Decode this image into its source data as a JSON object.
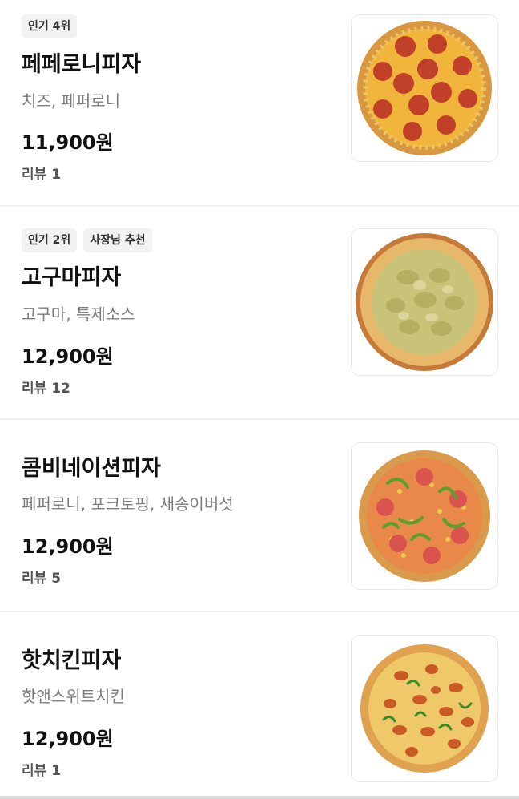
{
  "menu_items": [
    {
      "badges": [
        "인기 4위"
      ],
      "name": "페페로니피자",
      "description": "치즈, 페퍼로니",
      "price": "11,900원",
      "reviews": "리뷰 1",
      "image_icon": "pepperoni-pizza-image"
    },
    {
      "badges": [
        "인기 2위",
        "사장님 추천"
      ],
      "name": "고구마피자",
      "description": "고구마, 특제소스",
      "price": "12,900원",
      "reviews": "리뷰 12",
      "image_icon": "sweet-potato-pizza-image"
    },
    {
      "badges": [],
      "name": "콤비네이션피자",
      "description": "페퍼로니, 포크토핑, 새송이버섯",
      "price": "12,900원",
      "reviews": "리뷰 5",
      "image_icon": "combination-pizza-image"
    },
    {
      "badges": [],
      "name": "핫치킨피자",
      "description": "핫앤스위트치킨",
      "price": "12,900원",
      "reviews": "리뷰 1",
      "image_icon": "hot-chicken-pizza-image"
    }
  ]
}
